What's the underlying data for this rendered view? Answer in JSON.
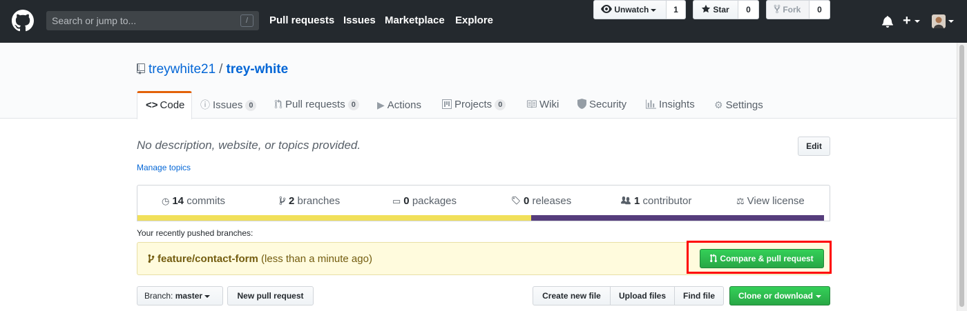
{
  "header": {
    "search_placeholder": "Search or jump to...",
    "search_shortcut": "/",
    "nav": [
      "Pull requests",
      "Issues",
      "Marketplace",
      "Explore"
    ],
    "plus": "+"
  },
  "repo": {
    "owner": "treywhite21",
    "separator": "/",
    "name": "trey-white",
    "watch_label": "Unwatch",
    "watch_count": "1",
    "star_label": "Star",
    "star_count": "0",
    "fork_label": "Fork",
    "fork_count": "0"
  },
  "tabs": [
    {
      "label": "Code",
      "icon": "code-icon"
    },
    {
      "label": "Issues",
      "count": "0",
      "icon": "issue-icon"
    },
    {
      "label": "Pull requests",
      "count": "0",
      "icon": "pull-request-icon"
    },
    {
      "label": "Actions",
      "icon": "play-icon"
    },
    {
      "label": "Projects",
      "count": "0",
      "icon": "project-icon"
    },
    {
      "label": "Wiki",
      "icon": "book-icon"
    },
    {
      "label": "Security",
      "icon": "shield-icon"
    },
    {
      "label": "Insights",
      "icon": "graph-icon"
    },
    {
      "label": "Settings",
      "icon": "gear-icon"
    }
  ],
  "about": {
    "description": "No description, website, or topics provided.",
    "edit_label": "Edit",
    "manage_topics": "Manage topics"
  },
  "numbers": [
    {
      "value": "14",
      "label": "commits"
    },
    {
      "value": "2",
      "label": "branches"
    },
    {
      "value": "0",
      "label": "packages"
    },
    {
      "value": "0",
      "label": "releases"
    },
    {
      "value": "1",
      "label": "contributor"
    },
    {
      "value": "",
      "label": "View license"
    }
  ],
  "language_colors": [
    "#f1e05a",
    "#563d7c"
  ],
  "recent": {
    "label": "Your recently pushed branches:",
    "branch": "feature/contact-form",
    "time": "(less than a minute ago)",
    "compare_label": "Compare & pull request"
  },
  "toolbar": {
    "branch_prefix": "Branch:",
    "branch_name": "master",
    "new_pr": "New pull request",
    "create_file": "Create new file",
    "upload_files": "Upload files",
    "find_file": "Find file",
    "clone": "Clone or download"
  }
}
